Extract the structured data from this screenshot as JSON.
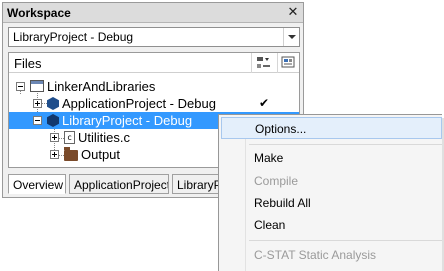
{
  "workspace": {
    "title": "Workspace",
    "configuration": "LibraryProject - Debug",
    "files_header": "Files",
    "header_icons": [
      "build-config-icon",
      "options-icon"
    ],
    "tree": [
      {
        "label": "LinkerAndLibraries",
        "icon": "workspace-icon",
        "expander": "minus",
        "checked": false,
        "selected": false
      },
      {
        "label": "ApplicationProject - Debug",
        "icon": "project-icon",
        "expander": "plus",
        "checked": true,
        "selected": false
      },
      {
        "label": "LibraryProject - Debug",
        "icon": "project-icon",
        "expander": "minus",
        "checked": false,
        "selected": true
      },
      {
        "label": "Utilities.c",
        "icon": "c-file-icon",
        "expander": "plus",
        "checked": false,
        "selected": false
      },
      {
        "label": "Output",
        "icon": "folder-icon",
        "expander": "plus",
        "checked": false,
        "selected": false
      }
    ],
    "check_mark": "✔",
    "tabs": [
      {
        "label": "Overview",
        "active": true
      },
      {
        "label": "ApplicationProject",
        "active": false
      },
      {
        "label": "LibraryProject",
        "active": false
      }
    ]
  },
  "context_menu": {
    "items": [
      {
        "label": "Options...",
        "enabled": true,
        "hover": true
      },
      {
        "label": "Make",
        "enabled": true
      },
      {
        "label": "Compile",
        "enabled": false
      },
      {
        "label": "Rebuild All",
        "enabled": true
      },
      {
        "label": "Clean",
        "enabled": true
      },
      {
        "label": "C-STAT Static Analysis",
        "enabled": false
      }
    ]
  },
  "colors": {
    "selection": "#3399ff",
    "menu_hover": "#e4effb",
    "project_icon": "#1f4e8c",
    "folder": "#7a4a2a"
  }
}
